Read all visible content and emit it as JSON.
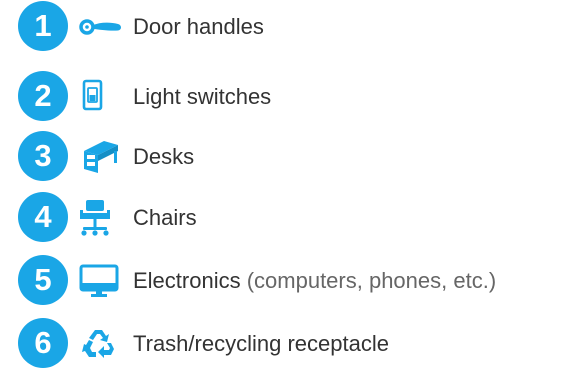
{
  "colors": {
    "accent": "#1aa6e6",
    "text": "#333333",
    "note": "#666666"
  },
  "items": [
    {
      "number": "1",
      "label": "Door handles",
      "note": "",
      "icon": "door-handle-icon"
    },
    {
      "number": "2",
      "label": "Light switches",
      "note": "",
      "icon": "light-switch-icon"
    },
    {
      "number": "3",
      "label": "Desks",
      "note": "",
      "icon": "desk-icon"
    },
    {
      "number": "4",
      "label": "Chairs",
      "note": "",
      "icon": "office-chair-icon"
    },
    {
      "number": "5",
      "label": "Electronics",
      "note": " (computers, phones, etc.)",
      "icon": "computer-monitor-icon"
    },
    {
      "number": "6",
      "label": "Trash/recycling receptacle",
      "note": "",
      "icon": "recycling-icon"
    }
  ]
}
